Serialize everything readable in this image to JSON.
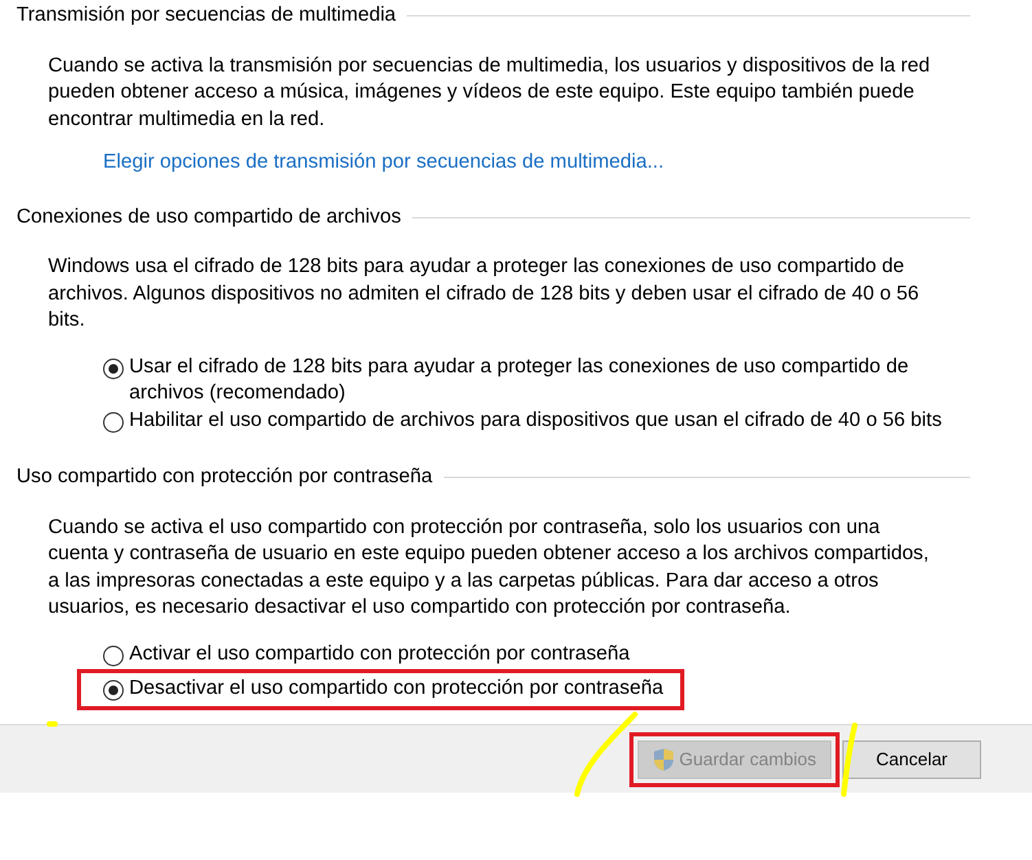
{
  "sections": [
    {
      "heading": "Transmisión por secuencias de multimedia",
      "description": "Cuando se activa la transmisión por secuencias de multimedia, los usuarios y dispositivos de la red pueden obtener acceso a música, imágenes y vídeos de este equipo. Este equipo también puede encontrar multimedia en la red.",
      "link": "Elegir opciones de transmisión por secuencias de multimedia..."
    },
    {
      "heading": "Conexiones de uso compartido de archivos",
      "description": "Windows usa el cifrado de 128 bits para ayudar a proteger las conexiones de uso compartido de archivos. Algunos dispositivos no admiten el cifrado de 128 bits y deben usar el cifrado de 40 o 56 bits.",
      "options": [
        {
          "label": "Usar el cifrado de 128 bits para ayudar a proteger las conexiones de uso compartido de archivos (recomendado)",
          "selected": true,
          "highlighted": false
        },
        {
          "label": "Habilitar el uso compartido de archivos para dispositivos que usan el cifrado de 40 o 56 bits",
          "selected": false,
          "highlighted": false
        }
      ]
    },
    {
      "heading": "Uso compartido con protección por contraseña",
      "description": "Cuando se activa el uso compartido con protección por contraseña, solo los usuarios con una cuenta y contraseña de usuario en este equipo pueden obtener acceso a los archivos compartidos, a las impresoras conectadas a este equipo y a las carpetas públicas. Para dar acceso a otros usuarios, es necesario desactivar el uso compartido con protección por contraseña.",
      "options": [
        {
          "label": "Activar el uso compartido con protección por contraseña",
          "selected": false,
          "highlighted": false
        },
        {
          "label": "Desactivar el uso compartido con protección por contraseña",
          "selected": true,
          "highlighted": true
        }
      ]
    }
  ],
  "buttons": [
    {
      "label": "Guardar cambios",
      "kind": "shield",
      "disabled": true,
      "highlighted": true
    },
    {
      "label": "Cancelar",
      "kind": "plain",
      "disabled": false,
      "highlighted": false
    }
  ]
}
